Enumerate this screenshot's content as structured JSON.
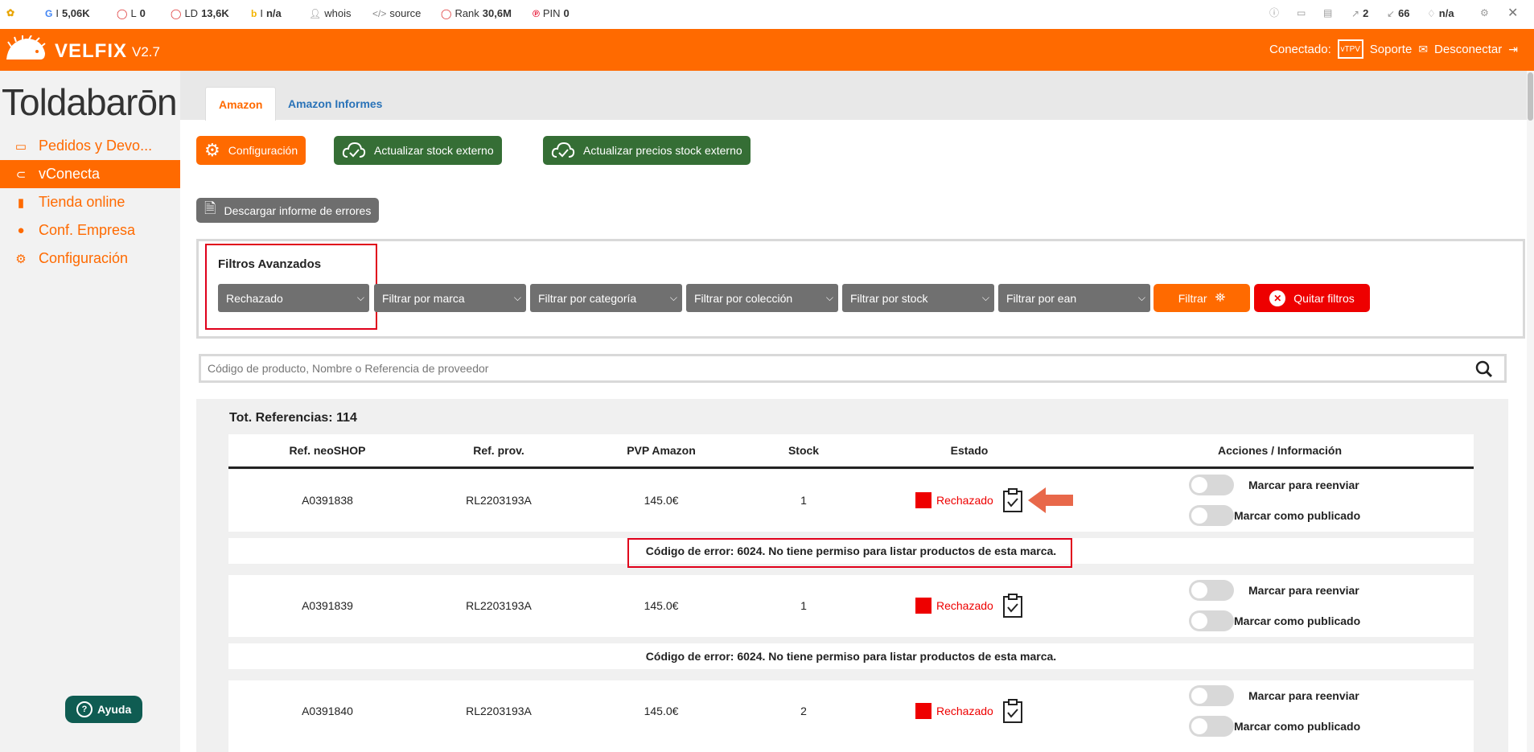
{
  "extbar": {
    "google_label": "I",
    "google_value": "5,06K",
    "l_label": "L",
    "l_value": "0",
    "ld_label": "LD",
    "ld_value": "13,6K",
    "bing_label": "I",
    "bing_value": "n/a",
    "whois": "whois",
    "source": "source",
    "rank_label": "Rank",
    "rank_value": "30,6M",
    "pin_label": "PIN",
    "pin_value": "0",
    "ext_links": "2",
    "int_links": "66",
    "diag_value": "n/a"
  },
  "header": {
    "app_name": "VELFIX",
    "version": "V2.7",
    "connected_label": "Conectado:",
    "tpv_label": "vTPV",
    "support_label": "Soporte",
    "logout_label": "Desconectar"
  },
  "sidebar": {
    "brand": "Toldabarōn",
    "items": [
      {
        "label": "Pedidos y Devo..."
      },
      {
        "label": "vConecta"
      },
      {
        "label": "Tienda online"
      },
      {
        "label": "Conf. Empresa"
      },
      {
        "label": "Configuración"
      }
    ],
    "help_label": "Ayuda"
  },
  "tabs": [
    {
      "label": "Amazon"
    },
    {
      "label": "Amazon Informes"
    }
  ],
  "toolbar": {
    "config_label": "Configuración",
    "update_stock_label": "Actualizar stock externo",
    "update_prices_label": "Actualizar precios stock externo",
    "download_errors_label": "Descargar informe de errores"
  },
  "filters": {
    "title": "Filtros Avanzados",
    "status_value": "Rechazado",
    "brand_placeholder": "Filtrar por marca",
    "category_placeholder": "Filtrar por categoría",
    "collection_placeholder": "Filtrar por colección",
    "stock_placeholder": "Filtrar por stock",
    "ean_placeholder": "Filtrar por ean",
    "filter_button": "Filtrar",
    "clear_button": "Quitar filtros"
  },
  "search": {
    "placeholder": "Código de producto, Nombre o Referencia de proveedor"
  },
  "table": {
    "total_label": "Tot. Referencias: 114",
    "headers": {
      "ref_neoshop": "Ref. neoSHOP",
      "ref_prov": "Ref. prov.",
      "pvp": "PVP Amazon",
      "stock": "Stock",
      "estado": "Estado",
      "acciones": "Acciones / Información"
    },
    "rows": [
      {
        "ref": "A0391838",
        "prov": "RL2203193A",
        "pvp": "145.0€",
        "stock": "1",
        "estado": "Rechazado",
        "resend_label": "Marcar para reenviar",
        "published_label": "Marcar como publicado",
        "error": "Código de error: 6024. No tiene permiso para listar productos de esta marca."
      },
      {
        "ref": "A0391839",
        "prov": "RL2203193A",
        "pvp": "145.0€",
        "stock": "1",
        "estado": "Rechazado",
        "resend_label": "Marcar para reenviar",
        "published_label": "Marcar como publicado",
        "error": "Código de error: 6024. No tiene permiso para listar productos de esta marca."
      },
      {
        "ref": "A0391840",
        "prov": "RL2203193A",
        "pvp": "145.0€",
        "stock": "2",
        "estado": "Rechazado",
        "resend_label": "Marcar para reenviar",
        "published_label": "Marcar como publicado"
      }
    ]
  },
  "colors": {
    "accent": "#ff6a00",
    "green": "#356e35",
    "rejected": "#e00000",
    "link": "#2a73b8",
    "help": "#0f5c52"
  }
}
